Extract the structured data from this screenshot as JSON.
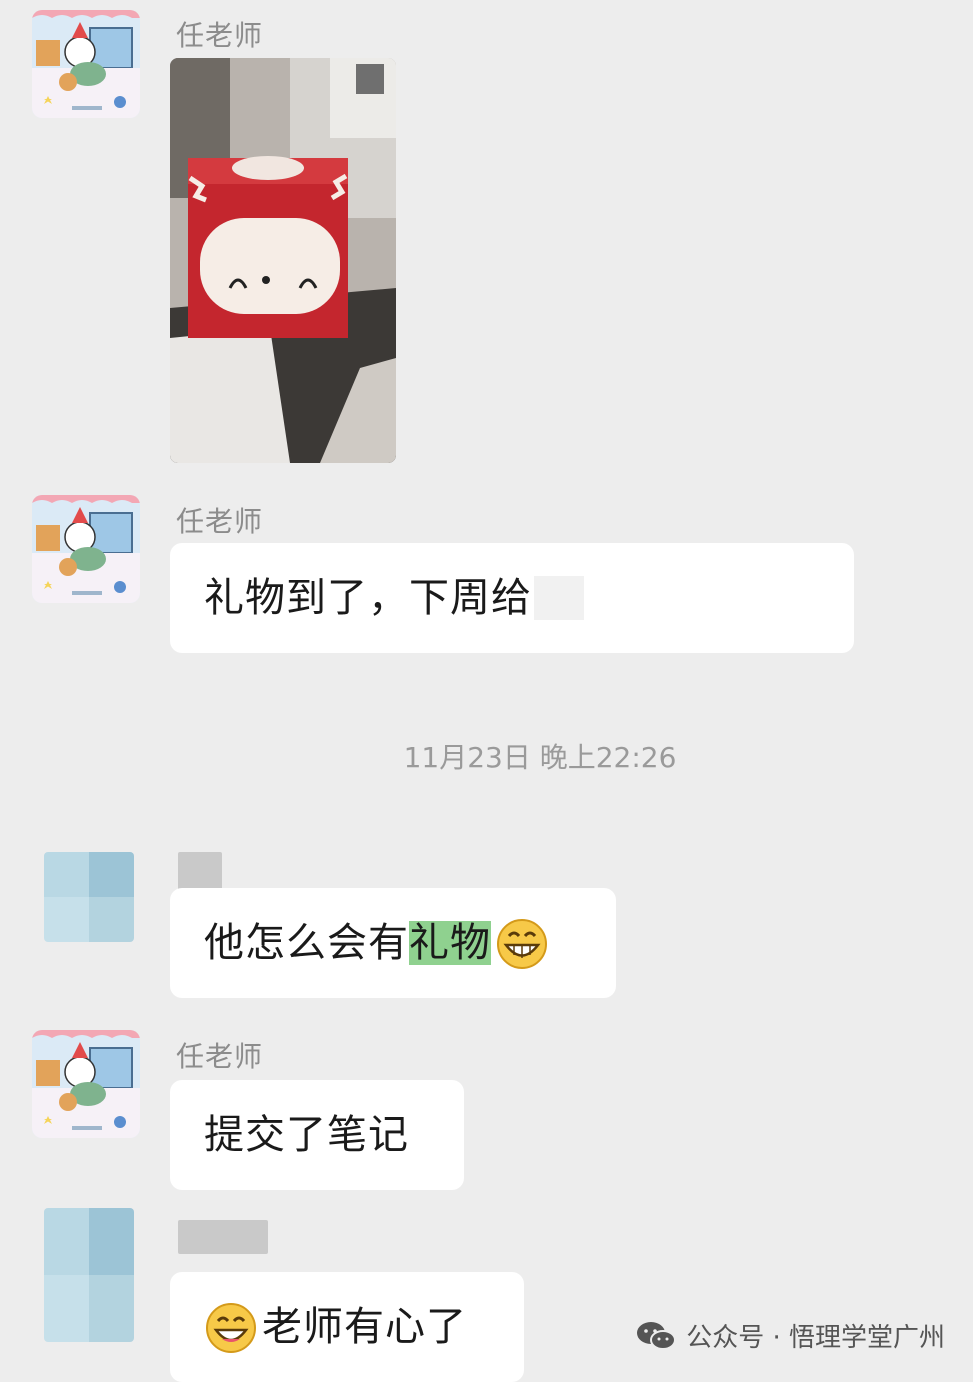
{
  "messages": [
    {
      "sender": "任老师",
      "type": "image",
      "image_desc_icon": "photo-red-gift-box"
    },
    {
      "sender": "任老师",
      "type": "text",
      "text": "礼物到了，下周给"
    },
    {
      "timestamp": "11月23日 晚上22:26"
    },
    {
      "sender": "",
      "type": "text",
      "text_before": "他怎么会有",
      "highlight": "礼物",
      "emoji": "grin-emoji"
    },
    {
      "sender": "任老师",
      "type": "text",
      "text": "提交了笔记"
    },
    {
      "sender": "",
      "type": "text",
      "emoji": "smile-emoji",
      "text": "老师有心了"
    }
  ],
  "watermark": {
    "icon": "wechat-icon",
    "label": "公众号 · 悟理学堂广州"
  },
  "colors": {
    "background": "#ededed",
    "bubble": "#ffffff",
    "highlight": "#8fd18f",
    "name": "#8c8c8c"
  }
}
